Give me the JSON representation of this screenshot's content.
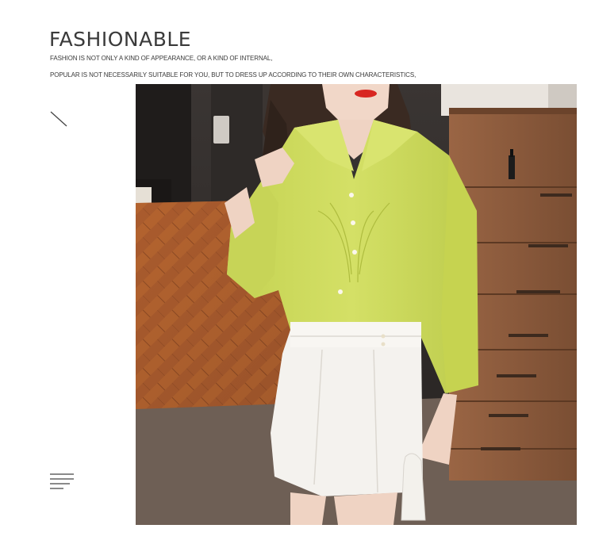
{
  "header": {
    "title": "FASHIONABLE",
    "tagline_line1": "FASHION IS NOT ONLY A KIND OF APPEARANCE, OR A KIND OF INTERNAL,",
    "tagline_line2": "POPULAR IS NOT NECESSARILY SUITABLE FOR YOU, BUT TO DRESS UP ACCORDING TO THEIR OWN CHARACTERISTICS,"
  },
  "icons": {
    "diagonal": "diagonal-line-icon",
    "menu": "menu-lines-icon"
  },
  "photo": {
    "subject": "model-wearing-lime-green-blouse-and-white-shorts",
    "colors": {
      "blouse": "#cbd95a",
      "shorts": "#f3f1ee",
      "floor": "#a0552c",
      "dresser": "#8e5f3f",
      "rug": "#6d5e53"
    }
  }
}
